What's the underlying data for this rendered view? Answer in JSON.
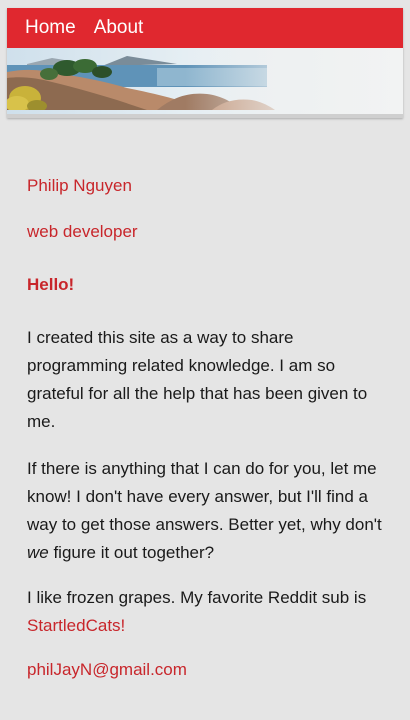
{
  "nav": {
    "home_label": "Home",
    "about_label": "About"
  },
  "profile": {
    "name": "Philip Nguyen",
    "title": "web developer"
  },
  "greeting": "Hello!",
  "paragraphs": {
    "p1": "I created this site as a way to share programming related knowledge. I am so grateful for all the help that has been given to me.",
    "p2_before": "If there is anything that I can do for you, let me know! I don't have every answer, but I'll find a way to get those answers. Better yet, why don't ",
    "p2_emphasis": "we",
    "p2_after": " figure it out together?",
    "p3_before": "I like frozen grapes. My favorite Reddit sub is ",
    "p3_link": "StartledCats!"
  },
  "contact": {
    "email": "philJayN@gmail.com"
  },
  "colors": {
    "accent": "#e0282f",
    "link": "#c8262b",
    "background": "#e5e5e5"
  }
}
